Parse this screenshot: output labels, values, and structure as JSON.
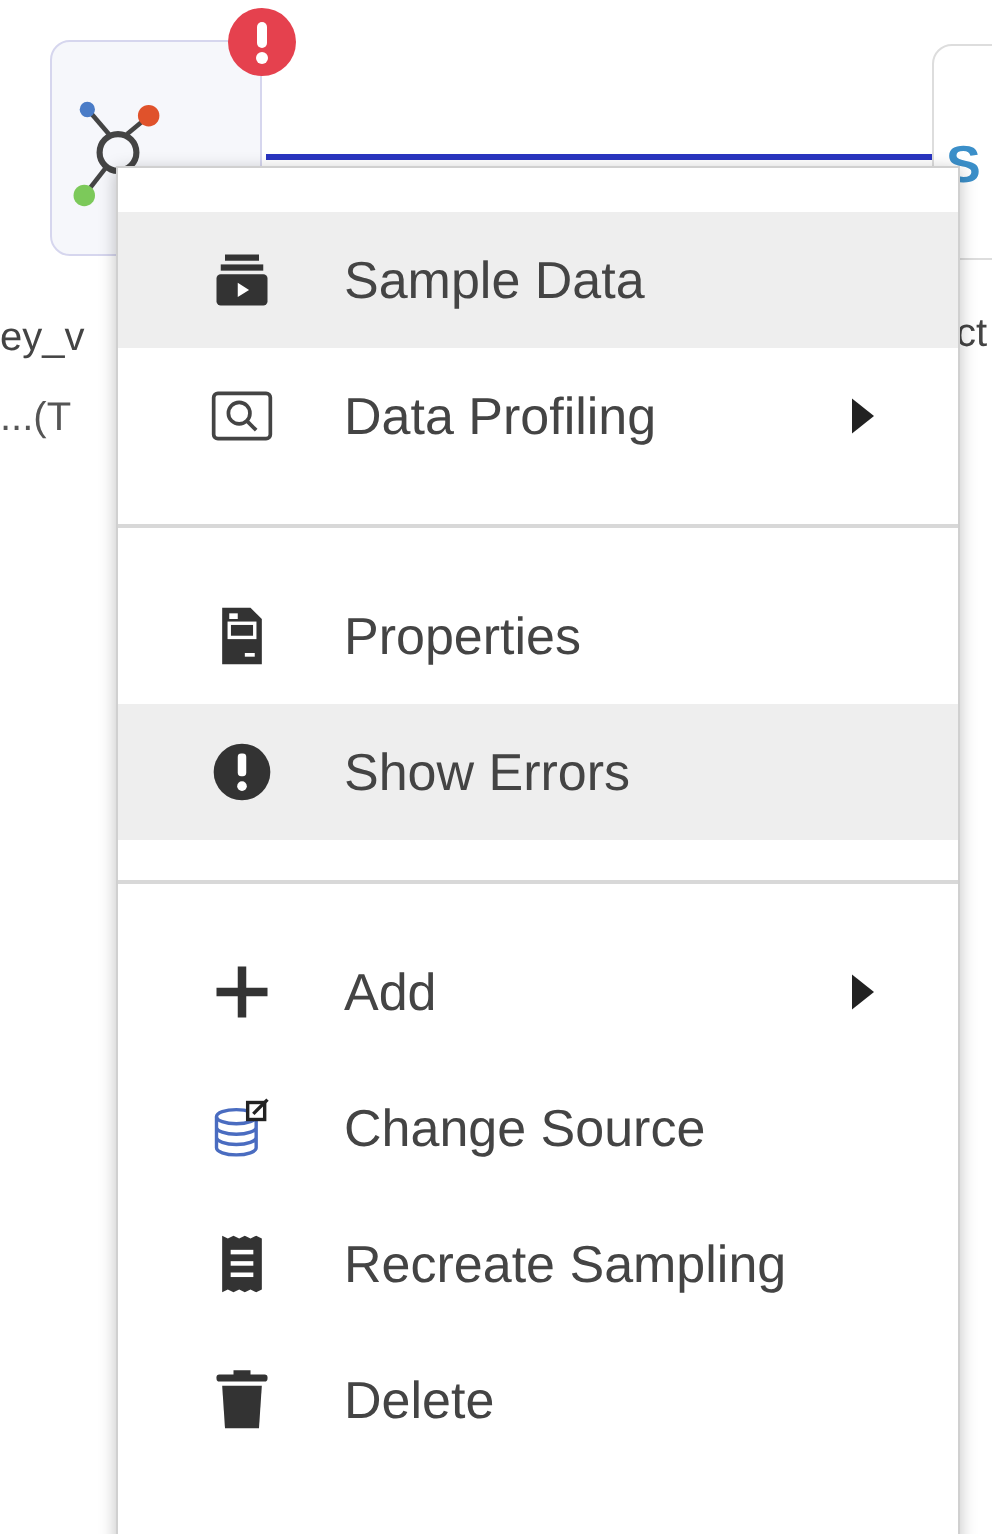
{
  "canvas": {
    "source_node": {
      "error_badge": true,
      "labels": [
        "ey_v",
        "...(T"
      ]
    },
    "target_node": {
      "title": "S",
      "labels": [
        "ct"
      ]
    }
  },
  "context_menu": {
    "sections": [
      [
        {
          "label": "Sample Data",
          "highlighted": true,
          "submenu": false
        },
        {
          "label": "Data Profiling",
          "highlighted": false,
          "submenu": true
        }
      ],
      [
        {
          "label": "Properties",
          "highlighted": false,
          "submenu": false
        },
        {
          "label": "Show Errors",
          "highlighted": true,
          "submenu": false
        }
      ],
      [
        {
          "label": "Add",
          "highlighted": false,
          "submenu": true
        },
        {
          "label": "Change Source",
          "highlighted": false,
          "submenu": false
        },
        {
          "label": "Recreate Sampling",
          "highlighted": false,
          "submenu": false
        },
        {
          "label": "Delete",
          "highlighted": false,
          "submenu": false
        }
      ]
    ]
  }
}
